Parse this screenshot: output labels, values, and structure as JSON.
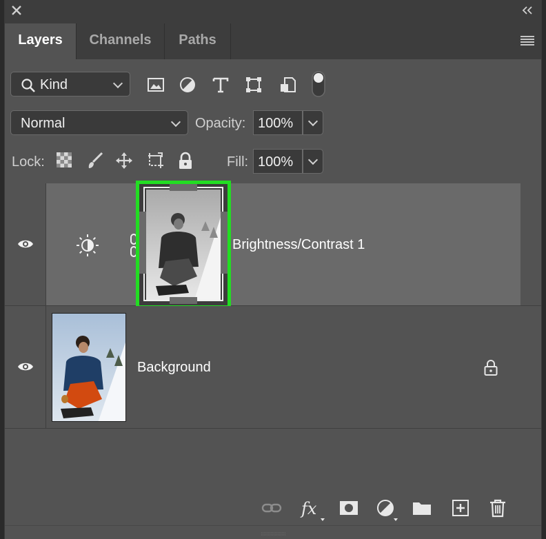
{
  "window": {
    "close_icon": "close-icon",
    "collapse_icon": "collapse-icon"
  },
  "tabs": [
    {
      "label": "Layers",
      "active": true
    },
    {
      "label": "Channels",
      "active": false
    },
    {
      "label": "Paths",
      "active": false
    }
  ],
  "filter": {
    "kind_label": "Kind",
    "icons": [
      "pixel-layer-filter-icon",
      "adjustment-layer-filter-icon",
      "type-layer-filter-icon",
      "shape-layer-filter-icon",
      "smart-object-filter-icon",
      "filter-toggle-icon"
    ]
  },
  "blend": {
    "mode": "Normal",
    "opacity_label": "Opacity:",
    "opacity_value": "100%"
  },
  "lock": {
    "label": "Lock:",
    "fill_label": "Fill:",
    "fill_value": "100%",
    "icons": [
      "lock-transparent-pixels-icon",
      "lock-image-pixels-icon",
      "lock-position-icon",
      "lock-artboard-icon",
      "lock-all-icon"
    ]
  },
  "layers": [
    {
      "name": "Brightness/Contrast 1",
      "type": "adjustment",
      "selected": true,
      "visible": true
    },
    {
      "name": "Background",
      "type": "pixel",
      "selected": false,
      "visible": true,
      "locked": true
    }
  ],
  "colors": {
    "panel_bg": "#535353",
    "tab_bar_bg": "#3d3d3d",
    "selected_row_bg": "#6a6a6a",
    "highlight_green": "#22dd22"
  },
  "bottom_icons": [
    "link-layers-icon",
    "fx-icon",
    "add-mask-icon",
    "new-adjustment-icon",
    "new-group-icon",
    "new-layer-icon",
    "trash-icon"
  ]
}
